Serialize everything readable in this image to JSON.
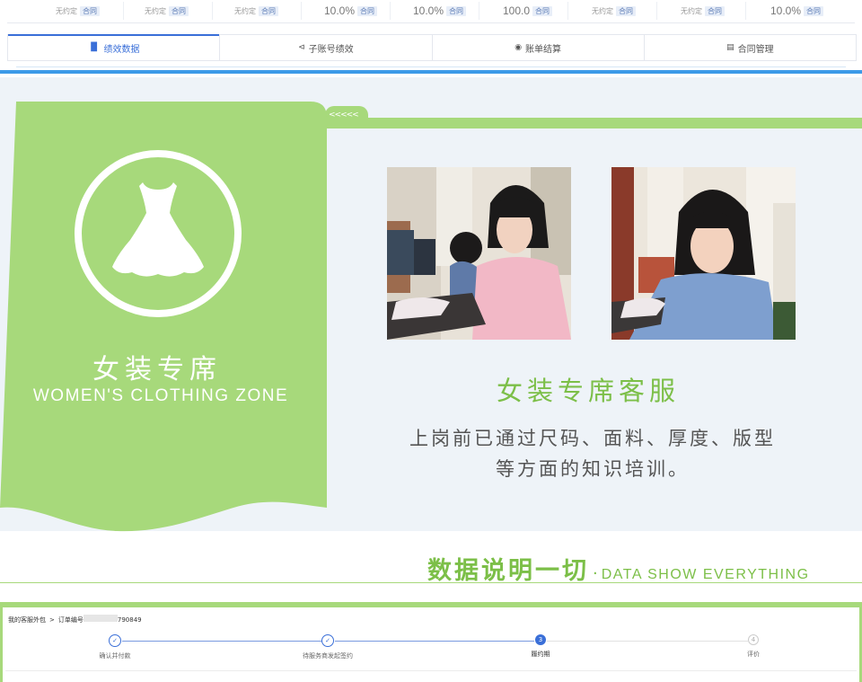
{
  "stats": [
    {
      "value": "无约定",
      "tag": "合同",
      "size": "small"
    },
    {
      "value": "无约定",
      "tag": "合同",
      "size": "small"
    },
    {
      "value": "无约定",
      "tag": "合同",
      "size": "small"
    },
    {
      "value": "10.0%",
      "tag": "合同",
      "size": "big"
    },
    {
      "value": "10.0%",
      "tag": "合同",
      "size": "big"
    },
    {
      "value": "100.0",
      "tag": "合同",
      "size": "big"
    },
    {
      "value": "无约定",
      "tag": "合同",
      "size": "small"
    },
    {
      "value": "无约定",
      "tag": "合同",
      "size": "small"
    },
    {
      "value": "10.0%",
      "tag": "合同",
      "size": "big"
    }
  ],
  "tabs": [
    {
      "label": "绩效数据",
      "icon": "bar-chart-icon",
      "active": true
    },
    {
      "label": "子账号绩效",
      "icon": "share-icon",
      "active": false
    },
    {
      "label": "账单结算",
      "icon": "car-icon",
      "active": false
    },
    {
      "label": "合同管理",
      "icon": "document-icon",
      "active": false
    }
  ],
  "feature": {
    "tab_glyphs": "<<<<<",
    "zone_title": "女装专席",
    "zone_subtitle": "WOMEN'S CLOTHING ZONE",
    "icon": "dress-icon",
    "cs_title": "女装专席客服",
    "cs_desc_line1": "上岗前已通过尺码、面料、厚度、版型",
    "cs_desc_line2": "等方面的知识培训。",
    "accent_color": "#a7d97b"
  },
  "data_heading": {
    "cn": "数据说明一切",
    "dot": "·",
    "en": "DATA SHOW EVERYTHING"
  },
  "order": {
    "breadcrumb_root": "我的客服外包",
    "breadcrumb_sep": ">",
    "order_prefix": "订单编号",
    "order_suffix": "790849",
    "steps": [
      {
        "label": "确认并付款",
        "state": "done",
        "mark": "✓"
      },
      {
        "label": "待服务商发起签约",
        "state": "done",
        "mark": "✓"
      },
      {
        "label": "履约期",
        "state": "current",
        "mark": "3"
      },
      {
        "label": "评价",
        "state": "todo",
        "mark": "4"
      }
    ]
  }
}
